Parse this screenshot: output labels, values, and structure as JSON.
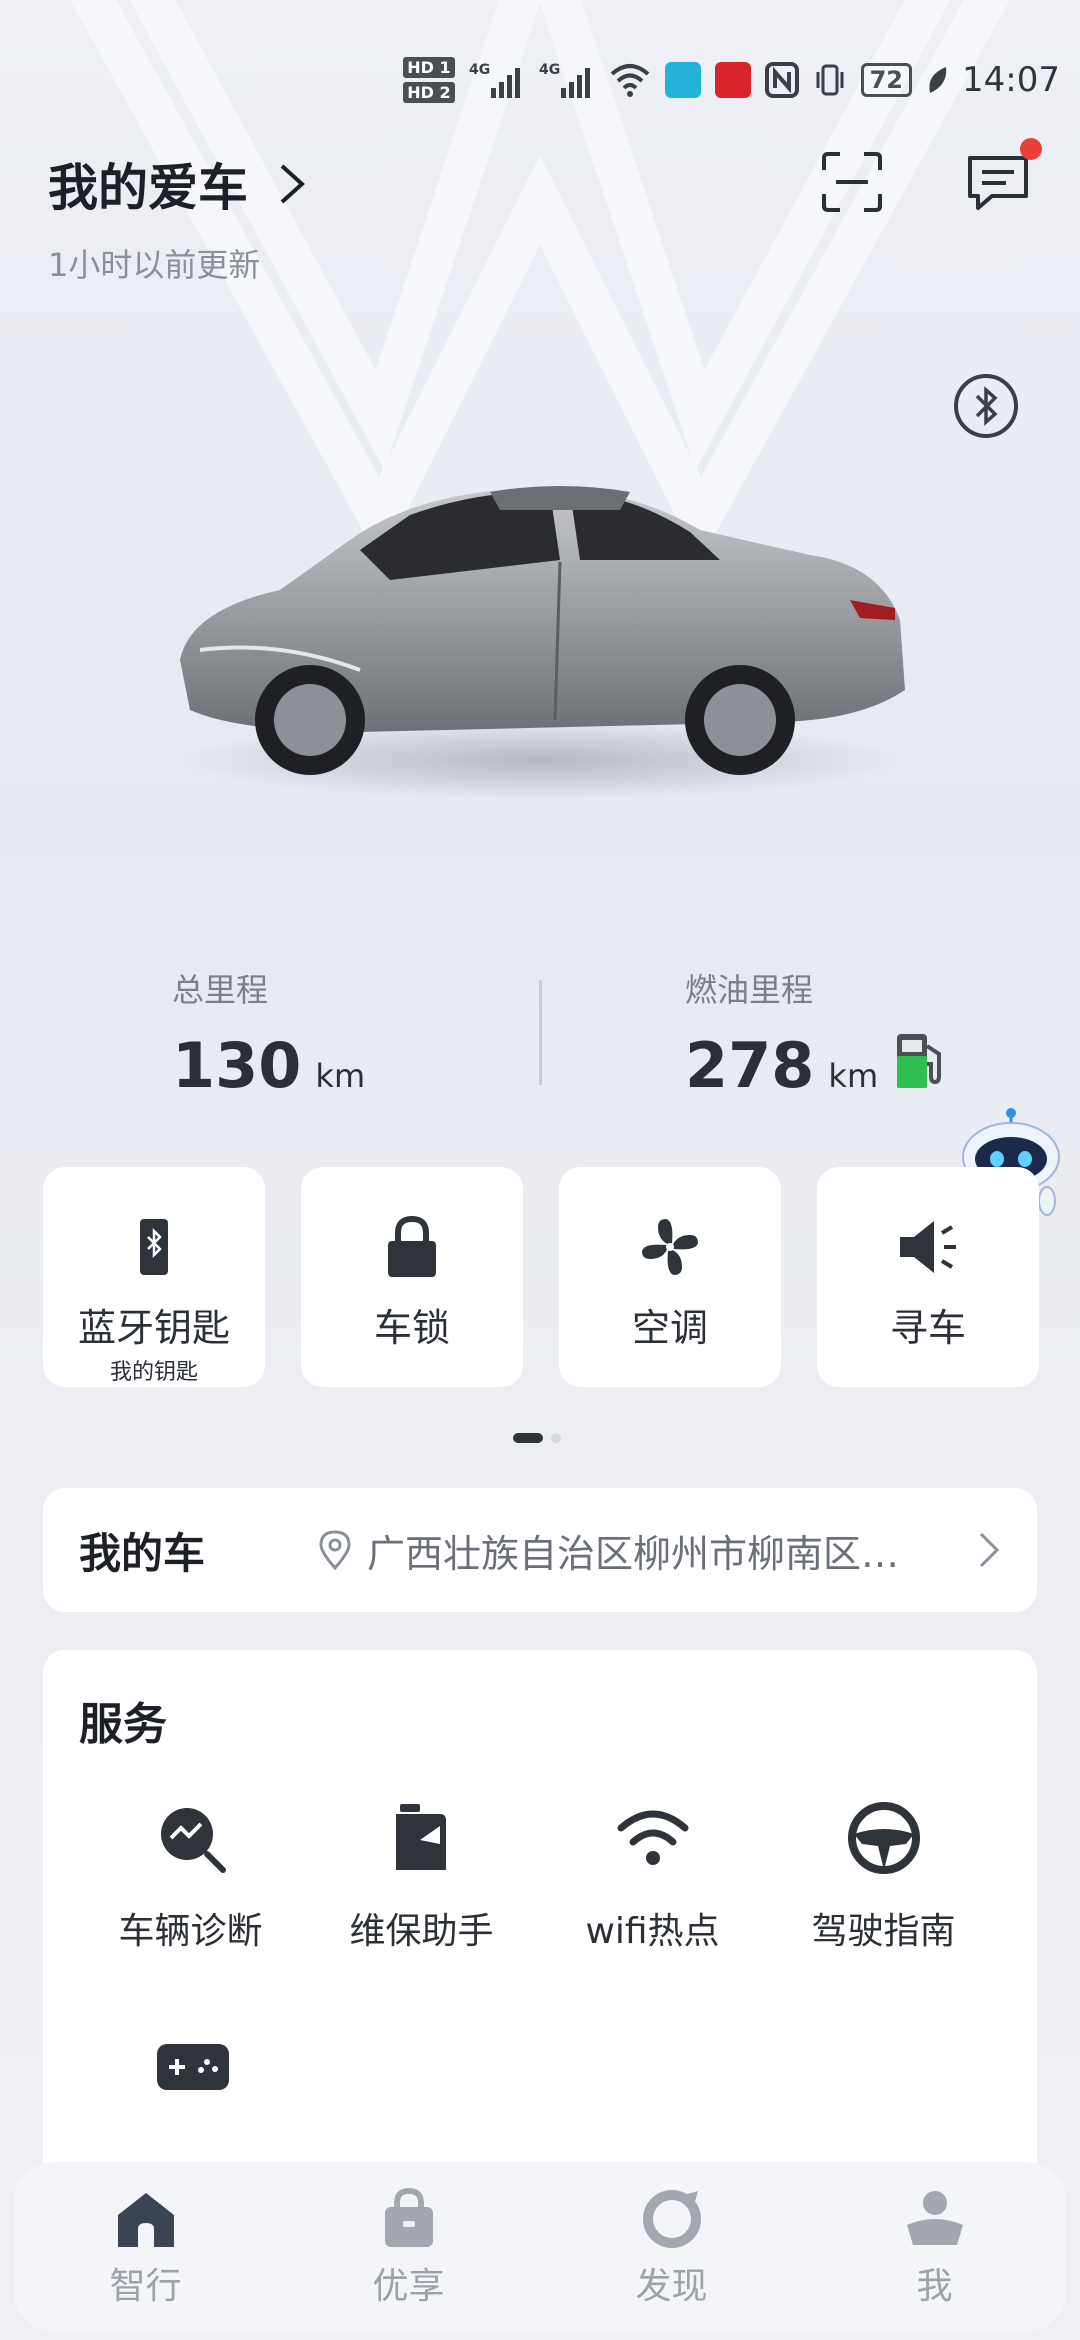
{
  "status_bar": {
    "hd1": "HD 1",
    "hd2": "HD 2",
    "signal1": "4G",
    "signal2": "4G",
    "battery": "72",
    "time": "14:07"
  },
  "header": {
    "title": "我的爱车",
    "updated": "1小时以前更新"
  },
  "stats": {
    "total_label": "总里程",
    "total_value": "130",
    "total_unit": "km",
    "fuel_label": "燃油里程",
    "fuel_value": "278",
    "fuel_unit": "km"
  },
  "controls": [
    {
      "label": "蓝牙钥匙",
      "sub": "我的钥匙",
      "icon": "bluetooth-key-icon"
    },
    {
      "label": "车锁",
      "icon": "lock-icon"
    },
    {
      "label": "空调",
      "icon": "fan-icon"
    },
    {
      "label": "寻车",
      "icon": "horn-icon"
    }
  ],
  "my_car": {
    "title": "我的车",
    "location": "广西壮族自治区柳州市柳南区…"
  },
  "services": {
    "title": "服务",
    "items": [
      {
        "label": "车辆诊断",
        "icon": "diagnosis-icon"
      },
      {
        "label": "维保助手",
        "icon": "maintenance-icon"
      },
      {
        "label": "wifi热点",
        "icon": "wifi-icon"
      },
      {
        "label": "驾驶指南",
        "icon": "steering-wheel-icon"
      }
    ]
  },
  "nav": [
    {
      "label": "智行",
      "icon": "home-icon"
    },
    {
      "label": "优享",
      "icon": "bag-icon"
    },
    {
      "label": "发现",
      "icon": "discover-icon"
    },
    {
      "label": "我",
      "icon": "profile-icon"
    }
  ],
  "colors": {
    "accent_dark": "#2f333a",
    "notification_dot": "#e8413c",
    "fuel_green": "#2fbf4f"
  }
}
